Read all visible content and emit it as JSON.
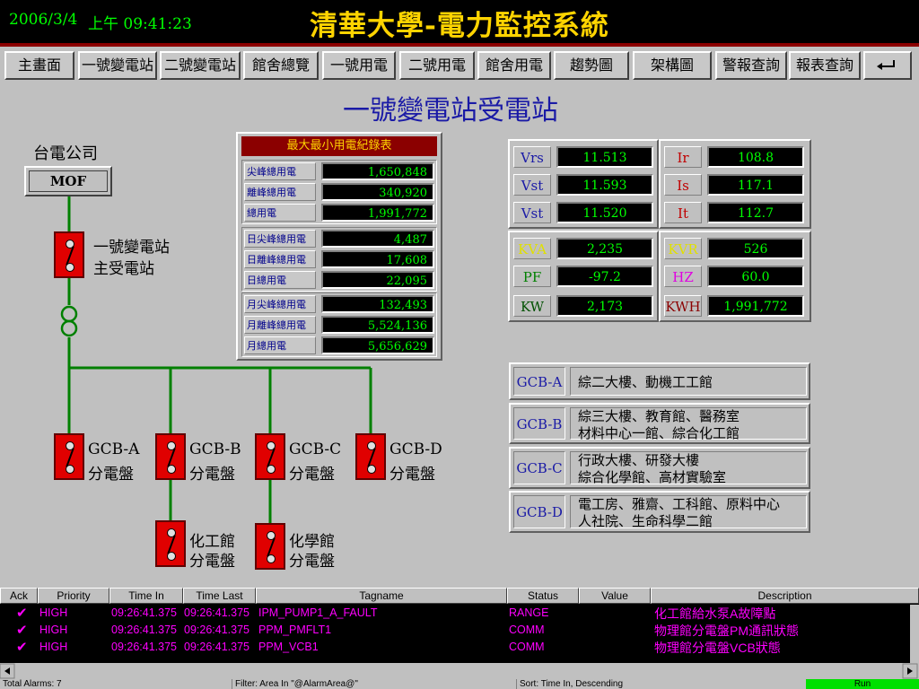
{
  "header": {
    "date": "2006/3/4",
    "time": "上午 09:41:23",
    "title": "清華大學-電力監控系統"
  },
  "nav": [
    "主畫面",
    "一號變電站",
    "二號變電站",
    "館舍總覽",
    "一號用電",
    "二號用電",
    "館舍用電",
    "趨勢圖",
    "架構圖",
    "警報查詢",
    "報表查詢"
  ],
  "page_title": "一號變電站受電站",
  "diagram": {
    "company": "台電公司",
    "mof": "MOF",
    "main_line1": "一號變電站",
    "main_line2": "主受電站",
    "feeders": [
      {
        "name": "GCB-A",
        "sub": "分電盤"
      },
      {
        "name": "GCB-B",
        "sub": "分電盤"
      },
      {
        "name": "GCB-C",
        "sub": "分電盤"
      },
      {
        "name": "GCB-D",
        "sub": "分電盤"
      }
    ],
    "branches": [
      {
        "name": "化工館",
        "sub": "分電盤"
      },
      {
        "name": "化學館",
        "sub": "分電盤"
      }
    ]
  },
  "record": {
    "title": "最大最小用電紀錄表",
    "rows": [
      {
        "label": "尖峰總用電",
        "value": "1,650,848"
      },
      {
        "label": "離峰總用電",
        "value": "340,920"
      },
      {
        "label": "總用電",
        "value": "1,991,772"
      },
      {
        "label": "日尖峰總用電",
        "value": "4,487"
      },
      {
        "label": "日離峰總用電",
        "value": "17,608"
      },
      {
        "label": "日總用電",
        "value": "22,095"
      },
      {
        "label": "月尖峰總用電",
        "value": "132,493"
      },
      {
        "label": "月離峰總用電",
        "value": "5,524,136"
      },
      {
        "label": "月總用電",
        "value": "5,656,629"
      }
    ]
  },
  "meas": {
    "voltage": [
      {
        "label": "Vrs",
        "value": "11.513"
      },
      {
        "label": "Vst",
        "value": "11.593"
      },
      {
        "label": "Vst",
        "value": "11.520"
      }
    ],
    "current": [
      {
        "label": "Ir",
        "value": "108.8"
      },
      {
        "label": "Is",
        "value": "117.1"
      },
      {
        "label": "It",
        "value": "112.7"
      }
    ],
    "left2": [
      {
        "label": "KVA",
        "value": "2,235"
      },
      {
        "label": "PF",
        "value": "-97.2"
      },
      {
        "label": "KW",
        "value": "2,173"
      }
    ],
    "right2": [
      {
        "label": "KVR",
        "value": "526"
      },
      {
        "label": "HZ",
        "value": "60.0"
      },
      {
        "label": "KWH",
        "value": "1,991,772"
      }
    ]
  },
  "gcb": [
    {
      "name": "GCB-A",
      "line1": "綜二大樓、動機工工館",
      "line2": ""
    },
    {
      "name": "GCB-B",
      "line1": "綜三大樓、教育館、醫務室",
      "line2": "材料中心一館、綜合化工館"
    },
    {
      "name": "GCB-C",
      "line1": "行政大樓、研發大樓",
      "line2": "綜合化學館、高材實驗室"
    },
    {
      "name": "GCB-D",
      "line1": "電工房、雅齋、工科館、原料中心",
      "line2": "人社院、生命科學二館"
    }
  ],
  "alarm": {
    "headers": [
      "Ack",
      "Priority",
      "Time In",
      "Time Last",
      "Tagname",
      "Status",
      "Value",
      "Description"
    ],
    "ack_mark": "✔",
    "rows": [
      {
        "priority": "HIGH",
        "time_in": "09:26:41.375",
        "time_last": "09:26:41.375",
        "tag": "IPM_PUMP1_A_FAULT",
        "status": "RANGE",
        "value": "",
        "desc": "化工館給水泵A故障點"
      },
      {
        "priority": "HIGH",
        "time_in": "09:26:41.375",
        "time_last": "09:26:41.375",
        "tag": "PPM_PMFLT1",
        "status": "COMM",
        "value": "",
        "desc": "物理館分電盤PM通訊狀態"
      },
      {
        "priority": "HIGH",
        "time_in": "09:26:41.375",
        "time_last": "09:26:41.375",
        "tag": "PPM_VCB1",
        "status": "COMM",
        "value": "",
        "desc": "物理館分電盤VCB狀態"
      }
    ]
  },
  "status": {
    "total": "Total Alarms: 7",
    "filter": "Filter: Area In \"@AlarmArea@\"",
    "sort": "Sort: Time In, Descending",
    "run": "Run"
  },
  "colors": {
    "wire": "#008000",
    "breaker": "#e00000",
    "lcd_text": "#00ff00",
    "alarm_text": "#ff00ff"
  }
}
